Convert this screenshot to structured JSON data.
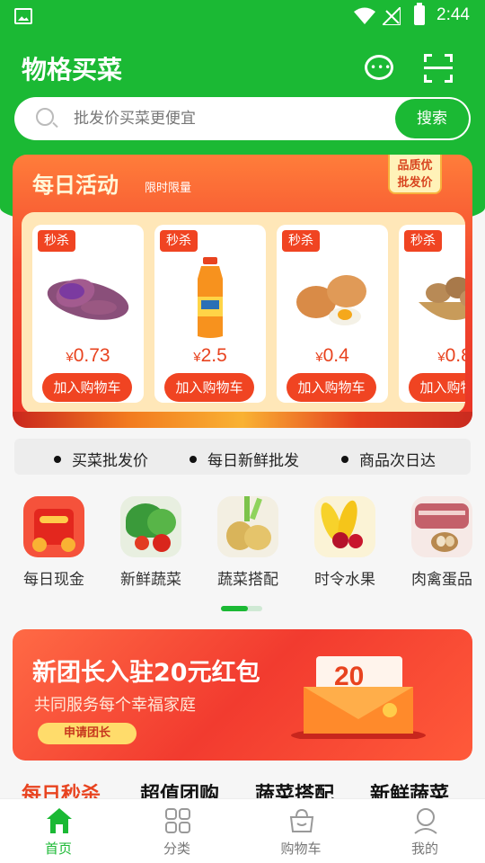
{
  "status_bar": {
    "time": "2:44"
  },
  "header": {
    "app_title": "物格买菜",
    "search_placeholder": "批发价买菜更便宜",
    "search_button": "搜索"
  },
  "activity": {
    "title": "每日活动",
    "subtitle": "限时限量",
    "badge_line1": "品质优",
    "badge_line2": "批发价",
    "products": [
      {
        "tag": "秒杀",
        "currency": "¥",
        "price": "0.73",
        "button": "加入购物车",
        "image": "purple-sweet-potato"
      },
      {
        "tag": "秒杀",
        "currency": "¥",
        "price": "2.5",
        "button": "加入购物车",
        "image": "orange-juice-bottle"
      },
      {
        "tag": "秒杀",
        "currency": "¥",
        "price": "0.4",
        "button": "加入购物车",
        "image": "eggs"
      },
      {
        "tag": "秒杀",
        "currency": "¥",
        "price": "0.8",
        "button": "加入购物车",
        "image": "potatoes-basket"
      }
    ]
  },
  "features": [
    "买菜批发价",
    "每日新鲜批发",
    "商品次日达"
  ],
  "categories": [
    {
      "label": "每日现金",
      "icon": "red-envelope-icon"
    },
    {
      "label": "新鲜蔬菜",
      "icon": "vegetables-icon"
    },
    {
      "label": "蔬菜搭配",
      "icon": "potato-onion-icon"
    },
    {
      "label": "时令水果",
      "icon": "fruit-icon"
    },
    {
      "label": "肉禽蛋品",
      "icon": "meat-eggs-icon"
    }
  ],
  "promo": {
    "title": "新团长入驻20元红包",
    "subtitle": "共同服务每个幸福家庭",
    "button": "申请团长",
    "envelope_amount": "20"
  },
  "section_tabs": [
    "每日秒杀",
    "超值团购",
    "蔬菜搭配",
    "新鲜蔬菜"
  ],
  "bottom_nav": [
    {
      "label": "首页",
      "icon": "home-icon",
      "active": true
    },
    {
      "label": "分类",
      "icon": "grid-icon",
      "active": false
    },
    {
      "label": "购物车",
      "icon": "cart-icon",
      "active": false
    },
    {
      "label": "我的",
      "icon": "profile-icon",
      "active": false
    }
  ],
  "colors": {
    "brand_green": "#1bb934",
    "accent_red": "#f04422"
  }
}
